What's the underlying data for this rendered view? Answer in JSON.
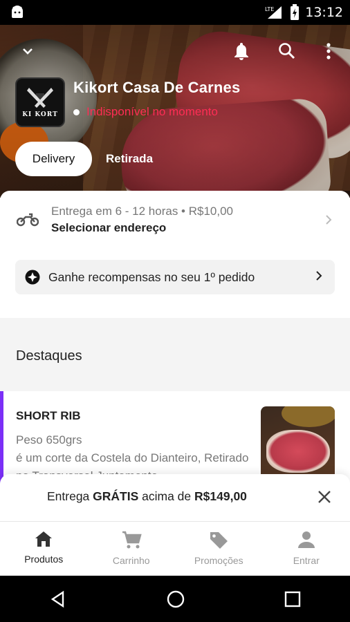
{
  "status_bar": {
    "time": "13:12",
    "network": "LTE"
  },
  "header": {
    "store_name": "Kikort Casa De Carnes",
    "store_status": "Indisponível no momento",
    "logo_text": "KI KORT",
    "modes": [
      {
        "label": "Delivery",
        "active": true
      },
      {
        "label": "Retirada",
        "active": false
      }
    ]
  },
  "delivery": {
    "estimate": "Entrega em 6 - 12 horas • R$10,00",
    "address_label": "Selecionar endereço"
  },
  "reward": {
    "label": "Ganhe recompensas no seu 1º pedido"
  },
  "section": {
    "title": "Destaques"
  },
  "product": {
    "name": "SHORT RIB",
    "description": "Peso 650grs\né um corte da Costela do Dianteiro, Retirado na Transversal Juntamente"
  },
  "banner": {
    "prefix": "Entrega ",
    "highlight1": "GRÁTIS",
    "middle": " acima de ",
    "highlight2": "R$149,00"
  },
  "bottom_nav": [
    {
      "label": "Produtos",
      "icon": "home-icon",
      "active": true
    },
    {
      "label": "Carrinho",
      "icon": "cart-icon",
      "active": false
    },
    {
      "label": "Promoções",
      "icon": "tag-icon",
      "active": false
    },
    {
      "label": "Entrar",
      "icon": "person-icon",
      "active": false
    }
  ],
  "colors": {
    "accent": "#7b2ff7",
    "status_red": "#ff2d55"
  }
}
